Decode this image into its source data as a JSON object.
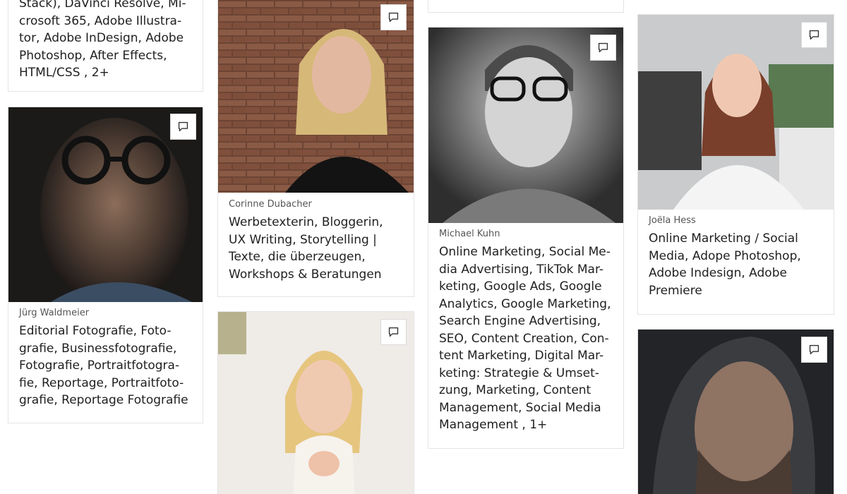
{
  "cards": {
    "top_left": {
      "skills": "Stack), DaVinci Resolve, Mi-\ncrosoft 365, Adobe Illustra-\ntor, Adobe InDesign, Adobe\nPhotoshop, After Effects,\nHTML/CSS , 2+"
    },
    "jurg": {
      "name": "Jürg Waldmeier",
      "skills": "Editorial Fotografie, Foto-\ngrafie, Businessfotografie,\nFotografie, Portraitfotogra-\nfie, Reportage, Portraitfoto-\ngrafie, Reportage Fotografie"
    },
    "corinne": {
      "name": "Corinne Dubacher",
      "skills": "Werbetexterin, Bloggerin,\nUX Writing, Storytelling |\nTexte, die überzeugen,\nWorkshops & Beratungen"
    },
    "michael": {
      "name": "Michael Kuhn",
      "skills": "Online Marketing, Social Me-\ndia Advertising, TikTok Mar-\nketing, Google Ads, Google\nAnalytics, Google Marketing,\nSearch Engine Advertising,\nSEO, Content Creation, Con-\ntent Marketing, Digital Mar-\nketing: Strategie & Umset-\nzung, Marketing, Content\nManagement, Social Media\nManagement , 1+"
    },
    "joela": {
      "name": "Joëla Hess",
      "skills": "Online Marketing / Social\nMedia, Adope Photoshop,\nAdobe Indesign, Adobe\nPremiere"
    }
  },
  "icons": {
    "message": "chat-bubble-icon"
  },
  "colors": {
    "border": "#e4e4e4",
    "text": "#1f1f1f",
    "muted": "#555555"
  }
}
